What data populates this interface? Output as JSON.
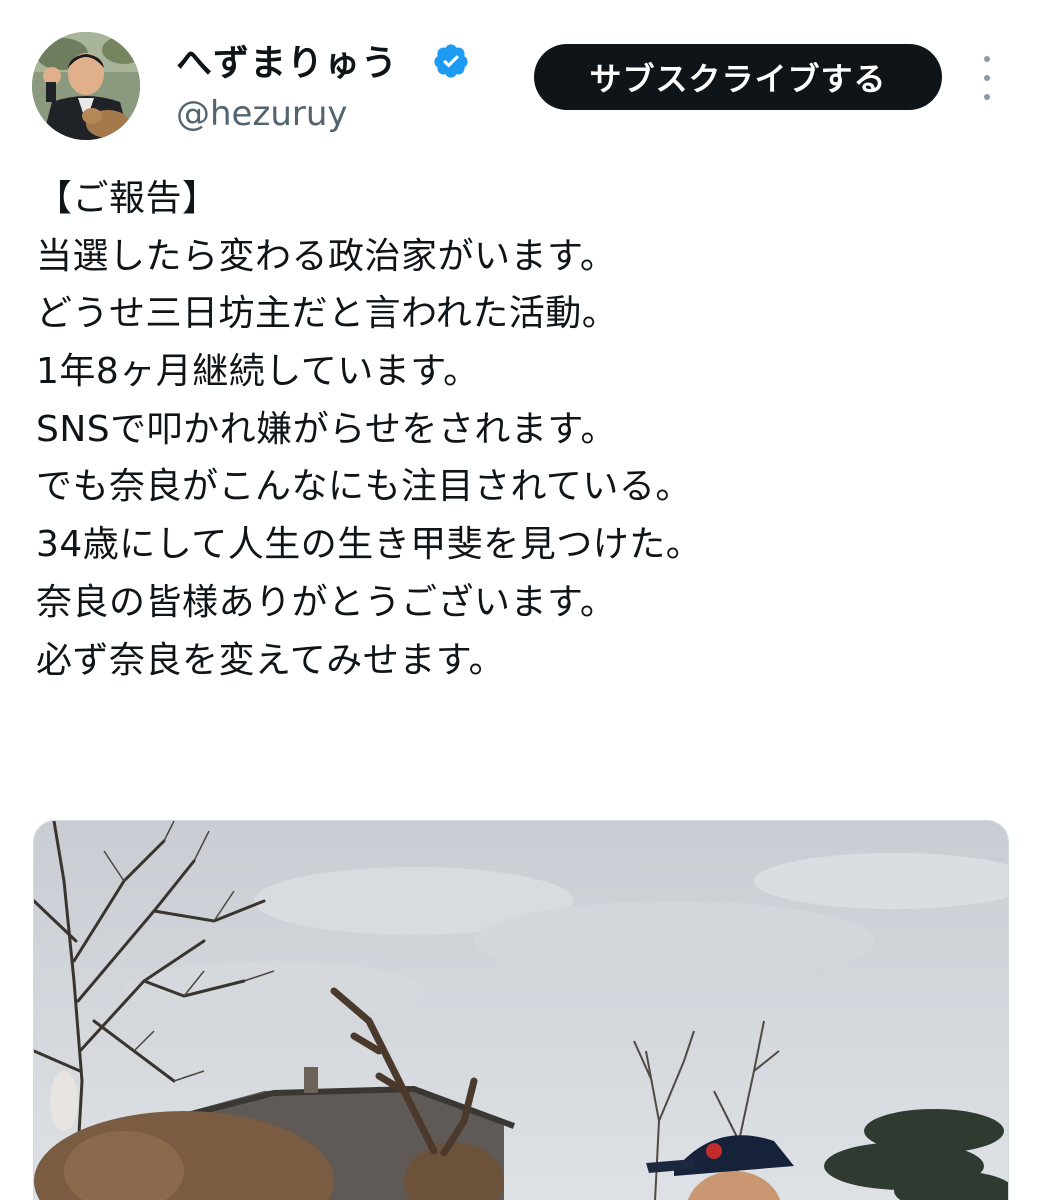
{
  "author": {
    "display_name": "へずまりゅう",
    "handle": "@hezuruy",
    "avatar_icon": "avatar-photo",
    "verified_icon": "verified-badge-icon",
    "verified_color": "#1d9bf0"
  },
  "actions": {
    "subscribe_label": "サブスクライブする",
    "more_icon": "more-vertical-icon"
  },
  "tweet": {
    "lines": [
      "【ご報告】",
      "当選したら変わる政治家がいます。",
      "どうせ三日坊主だと言われた活動。",
      "1年8ヶ月継続しています。",
      "SNSで叩かれ嫌がらせをされます。",
      "でも奈良がこんなにも注目されている。",
      "34歳にして人生の生き甲斐を見つけた。",
      "奈良の皆様ありがとうございます。",
      "必ず奈良を変えてみせます。"
    ]
  },
  "media": {
    "type": "photo",
    "icon": "photo-deer-and-man"
  },
  "colors": {
    "text": "#0f1419",
    "secondary": "#536471",
    "button_bg": "#0f1419",
    "button_text": "#ffffff"
  }
}
